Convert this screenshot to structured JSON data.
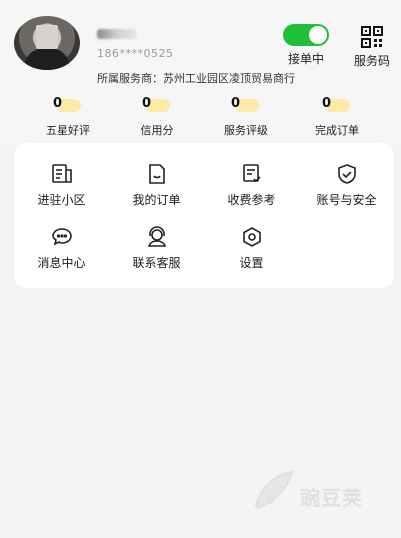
{
  "profile": {
    "username": "",
    "phone": "186****0525",
    "provider": "所属服务商：苏州工业园区凌顶贸易商行"
  },
  "toggle": {
    "label": "接单中",
    "state": "on",
    "color": "#1fbf3a"
  },
  "qr": {
    "label": "服务码",
    "icon": "qr-code-icon"
  },
  "stats": [
    {
      "value": "0",
      "label": "五星好评"
    },
    {
      "value": "0",
      "label": "信用分"
    },
    {
      "value": "0",
      "label": "服务评级"
    },
    {
      "value": "0",
      "label": "完成订单"
    }
  ],
  "menu": [
    {
      "label": "进驻小区",
      "icon": "building-doc-icon"
    },
    {
      "label": "我的订单",
      "icon": "order-doc-icon"
    },
    {
      "label": "收费参考",
      "icon": "fee-reference-icon"
    },
    {
      "label": "账号与安全",
      "icon": "shield-check-icon"
    },
    {
      "label": "消息中心",
      "icon": "message-bubble-icon"
    },
    {
      "label": "联系客服",
      "icon": "customer-service-icon"
    },
    {
      "label": "设置",
      "icon": "settings-icon"
    }
  ],
  "watermark": {
    "text": "豌豆荚"
  },
  "colors": {
    "background": "#f4f4f6",
    "card": "#ffffff",
    "accent": "#1fbf3a",
    "stat_highlight": "#fde9a8"
  }
}
